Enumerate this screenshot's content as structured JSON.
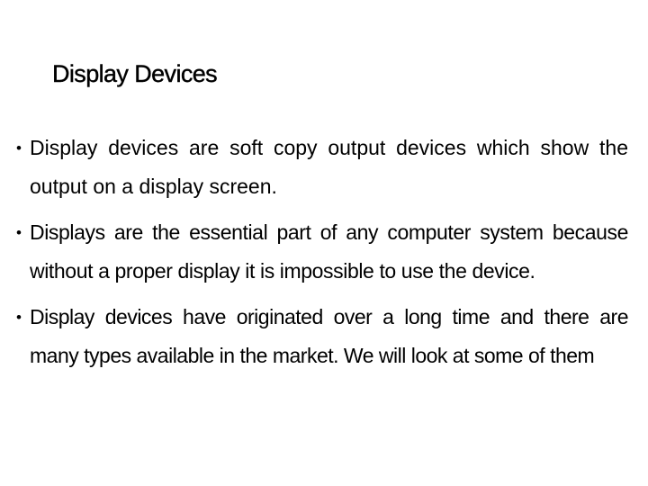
{
  "slide": {
    "title": "Display Devices",
    "bullet_glyph": "•",
    "bullets": [
      "Display devices are soft copy output devices which show the output on a display screen.",
      "Displays are the essential part of any computer system because without a proper display it is impossible to use the device.",
      "Display devices have originated over a long time and there are many types available in the market. We will look at some of them"
    ]
  }
}
